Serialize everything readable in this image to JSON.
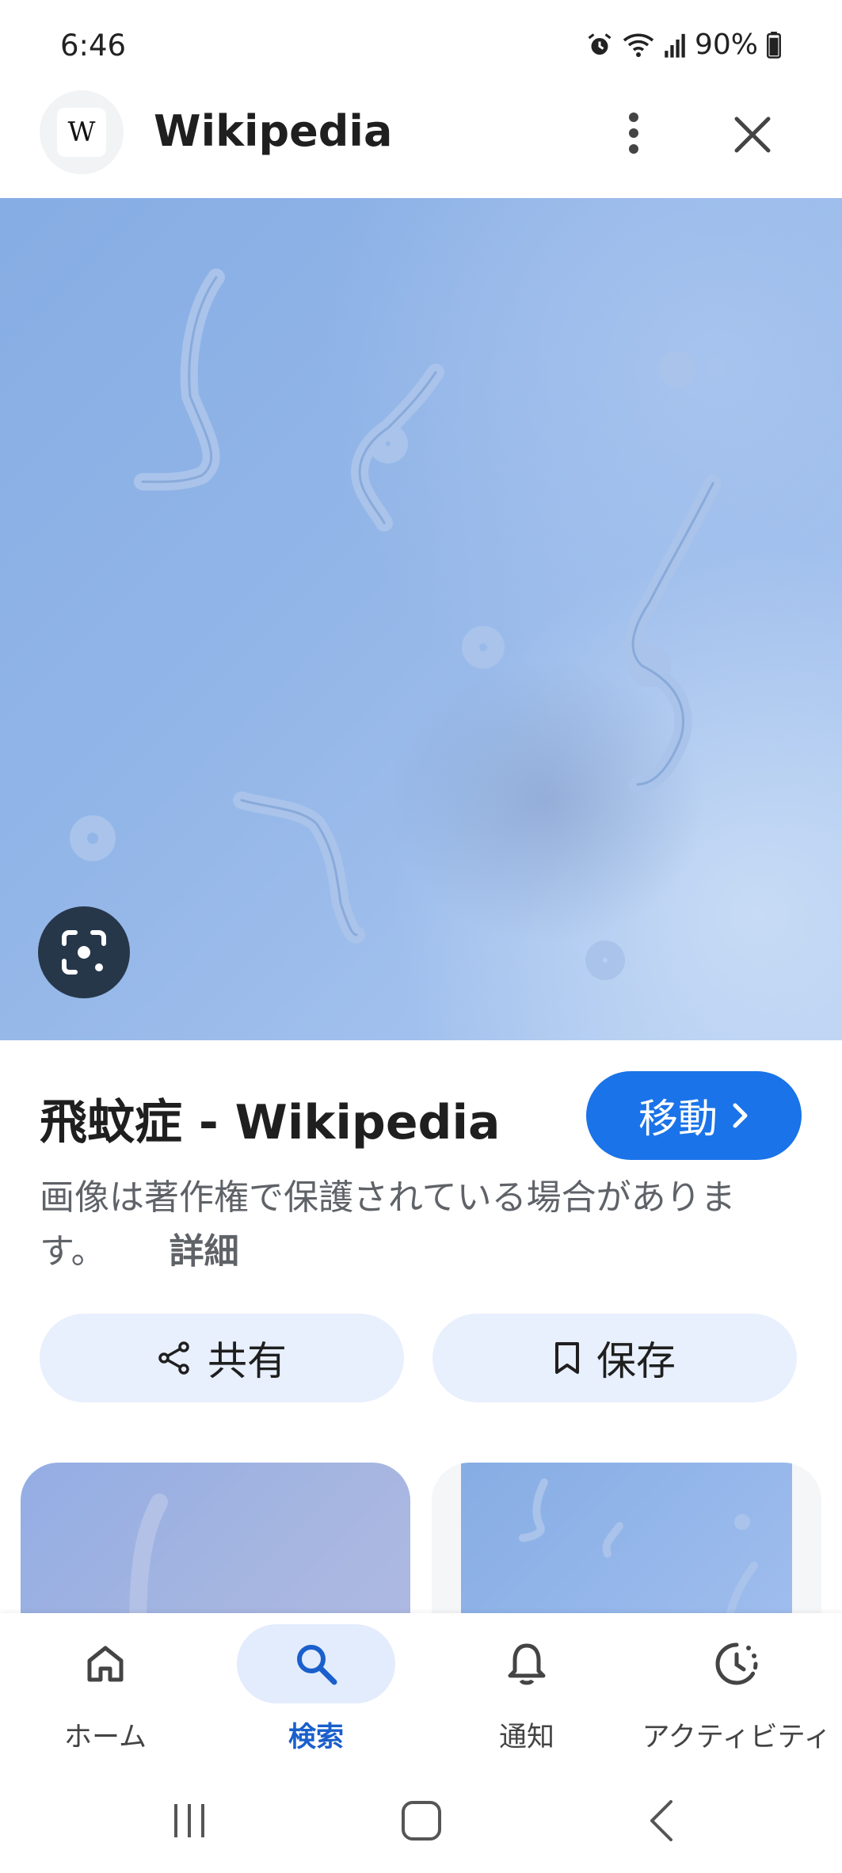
{
  "status_bar": {
    "time": "6:46",
    "battery": "90%",
    "icons": [
      "alarm-icon",
      "wifi-icon",
      "signal-icon",
      "battery-icon"
    ]
  },
  "header": {
    "logo_letter": "W",
    "title": "Wikipedia"
  },
  "result": {
    "title": "飛蚊症 - Wikipedia",
    "visit_label": "移動",
    "copyright_text": "画像は著作権で保護されている場合があります。",
    "details_label": "詳細"
  },
  "actions": {
    "share_label": "共有",
    "save_label": "保存"
  },
  "bottom_nav": {
    "items": [
      {
        "label": "ホーム",
        "icon": "home-icon",
        "active": false
      },
      {
        "label": "検索",
        "icon": "search-icon",
        "active": true
      },
      {
        "label": "通知",
        "icon": "bell-icon",
        "active": false
      },
      {
        "label": "アクティビティ",
        "icon": "activity-icon",
        "active": false
      }
    ]
  },
  "colors": {
    "accent": "#1a73e8",
    "action_bg": "#e8effd",
    "active_nav_bg": "#e3ecfc",
    "lens_bg": "#27374a"
  }
}
